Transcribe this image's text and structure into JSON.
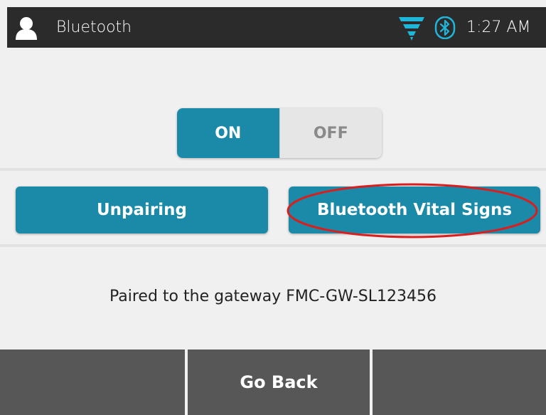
{
  "header": {
    "title": "Bluetooth",
    "time": "1:27 AM",
    "icons": {
      "user": "user-avatar-icon",
      "signal": "signal-strength-icon",
      "bluetooth": "bluetooth-icon"
    }
  },
  "toggle": {
    "on_label": "ON",
    "off_label": "OFF",
    "selected": "ON"
  },
  "actions": {
    "unpairing_label": "Unpairing",
    "vital_signs_label": "Bluetooth Vital Signs"
  },
  "status": {
    "text": "Paired to the gateway FMC-GW-SL123456"
  },
  "footer": {
    "left_label": "",
    "center_label": "Go Back",
    "right_label": ""
  },
  "colors": {
    "accent": "#1b8aa8",
    "header_bg": "#2b2b2b",
    "footer_bg": "#575757",
    "background": "#f0f0f0",
    "highlight": "#d81e1e"
  }
}
